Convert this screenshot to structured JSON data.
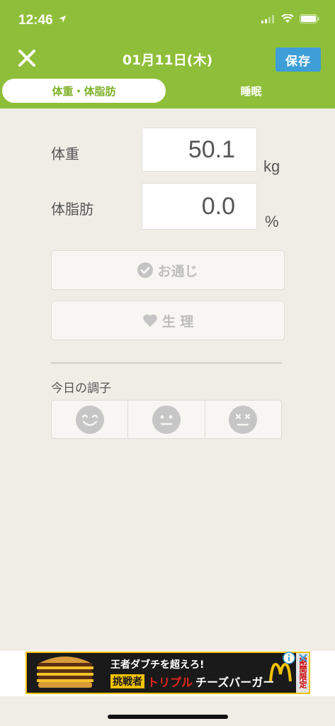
{
  "status_bar": {
    "time": "12:46"
  },
  "nav": {
    "title": "01月11日(木)",
    "save_label": "保存"
  },
  "tabs": [
    {
      "label": "体重・体脂肪",
      "active": true
    },
    {
      "label": "睡眠",
      "active": false
    }
  ],
  "form": {
    "weight": {
      "label": "体重",
      "value": "50.1",
      "unit": "kg"
    },
    "body_fat": {
      "label": "体脂肪",
      "value": "0.0",
      "unit": "%"
    },
    "bowel_button": "お通じ",
    "period_button": "生 理",
    "condition_label": "今日の調子",
    "moods": [
      "smile-face-icon",
      "neutral-face-icon",
      "dizzy-face-icon"
    ]
  },
  "ad": {
    "headline": "王者ダブチを超えろ!",
    "tag": "挑戦者",
    "product_red": "トリプル",
    "product_white": "チーズバーガー",
    "limited": "期間限定"
  },
  "colors": {
    "header": "#8fbf3a",
    "accent_text": "#7fb12a",
    "save_button": "#3e9ed8",
    "background": "#efede6"
  }
}
